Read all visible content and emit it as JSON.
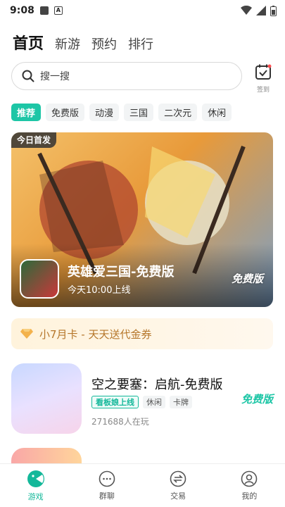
{
  "status_bar": {
    "time": "9:08",
    "indicator": "A"
  },
  "top_tabs": [
    {
      "label": "首页",
      "active": true
    },
    {
      "label": "新游",
      "active": false
    },
    {
      "label": "预约",
      "active": false
    },
    {
      "label": "排行",
      "active": false
    }
  ],
  "search": {
    "placeholder": "搜一搜"
  },
  "checkin": {
    "label": "签到"
  },
  "categories": [
    {
      "label": "推荐",
      "active": true
    },
    {
      "label": "免费版",
      "active": false
    },
    {
      "label": "动漫",
      "active": false
    },
    {
      "label": "三国",
      "active": false
    },
    {
      "label": "二次元",
      "active": false
    },
    {
      "label": "休闲",
      "active": false
    }
  ],
  "banner": {
    "badge": "今日首发",
    "title": "英雄爱三国-免费版",
    "subtitle": "今天10:00上线",
    "free_label": "免费版"
  },
  "promo": {
    "text": "小7月卡 - 天天送代金券"
  },
  "game": {
    "title": "空之要塞：启航-免费版",
    "tags": [
      "看板娘上线",
      "休闲",
      "卡牌"
    ],
    "players": "271688人在玩",
    "free_label": "免费版"
  },
  "bottom_nav": [
    {
      "label": "游戏",
      "icon": "game-icon",
      "active": true
    },
    {
      "label": "群聊",
      "icon": "chat-icon",
      "active": false
    },
    {
      "label": "交易",
      "icon": "trade-icon",
      "active": false
    },
    {
      "label": "我的",
      "icon": "profile-icon",
      "active": false
    }
  ],
  "colors": {
    "accent": "#1dc6a6",
    "promo_text": "#b5762a"
  }
}
